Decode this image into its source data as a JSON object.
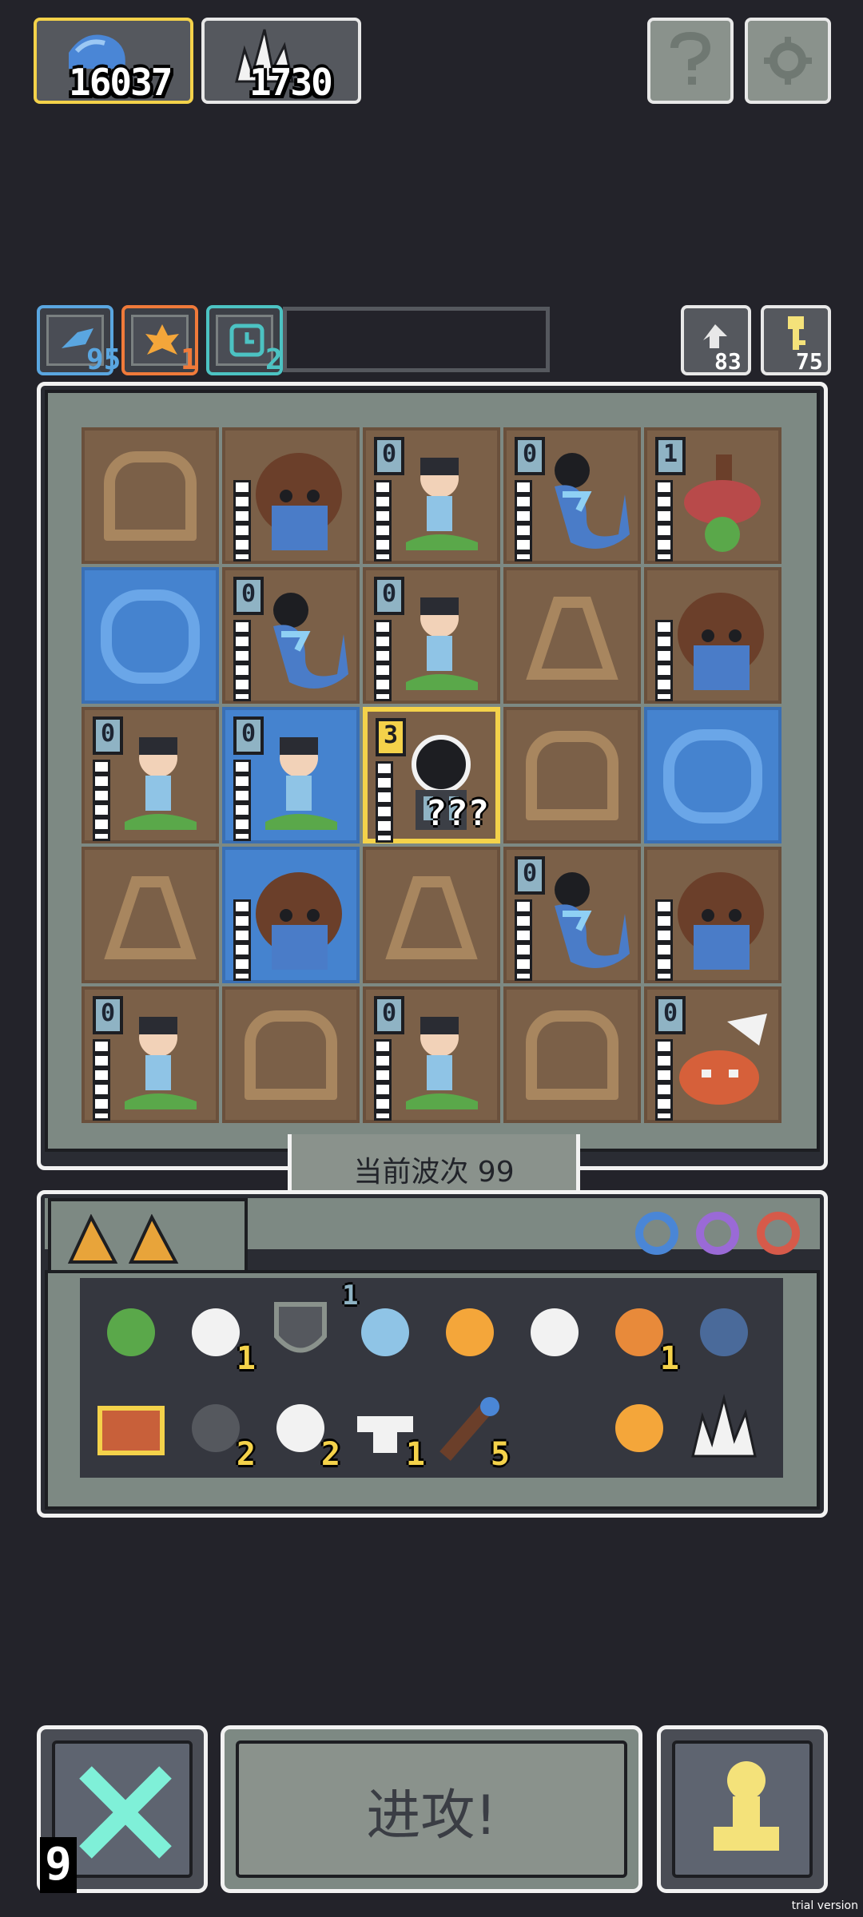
{
  "resources": {
    "water": "16037",
    "crystal": "1730"
  },
  "top_buttons": {
    "help_icon": "question-icon",
    "settings_icon": "gear-icon"
  },
  "status": {
    "skills": [
      {
        "icon": "bird-icon",
        "value": "95",
        "color": "#5aa6e0"
      },
      {
        "icon": "flame-icon",
        "value": "1",
        "color": "#f07a3a"
      },
      {
        "icon": "clock-icon",
        "value": "2",
        "color": "#4cc3c3"
      }
    ],
    "right": [
      {
        "icon": "recycle-icon",
        "value": "83"
      },
      {
        "icon": "key-icon",
        "value": "75"
      }
    ]
  },
  "board": {
    "cells": [
      {
        "tile": "arch",
        "unit": "",
        "level": ""
      },
      {
        "tile": "arch",
        "unit": "tree-golem",
        "level": ""
      },
      {
        "tile": "arch",
        "unit": "snake-maiden",
        "level": "0"
      },
      {
        "tile": "arch",
        "unit": "sea-serpent",
        "level": "0"
      },
      {
        "tile": "arch",
        "unit": "flower-monster",
        "level": "1"
      },
      {
        "tile": "water",
        "unit": "",
        "level": ""
      },
      {
        "tile": "arch",
        "unit": "sea-serpent",
        "level": "0"
      },
      {
        "tile": "arch",
        "unit": "snake-maiden",
        "level": "0"
      },
      {
        "tile": "tri",
        "unit": "",
        "level": ""
      },
      {
        "tile": "arch",
        "unit": "tree-golem",
        "level": ""
      },
      {
        "tile": "arch",
        "unit": "snake-maiden",
        "level": "0"
      },
      {
        "tile": "water",
        "unit": "snake-maiden",
        "level": "0"
      },
      {
        "tile": "sel",
        "unit": "dark-portal",
        "level": "3",
        "mystery": "???"
      },
      {
        "tile": "arch",
        "unit": "",
        "level": ""
      },
      {
        "tile": "water",
        "unit": "",
        "level": ""
      },
      {
        "tile": "tri",
        "unit": "",
        "level": ""
      },
      {
        "tile": "water",
        "unit": "tree-golem",
        "level": ""
      },
      {
        "tile": "tri",
        "unit": "",
        "level": ""
      },
      {
        "tile": "arch",
        "unit": "sea-serpent",
        "level": "0"
      },
      {
        "tile": "arch",
        "unit": "tree-golem",
        "level": ""
      },
      {
        "tile": "arch",
        "unit": "snake-maiden",
        "level": "0"
      },
      {
        "tile": "arch",
        "unit": "",
        "level": ""
      },
      {
        "tile": "arch",
        "unit": "snake-maiden",
        "level": "0"
      },
      {
        "tile": "arch",
        "unit": "",
        "level": ""
      },
      {
        "tile": "arch",
        "unit": "winged-tiger",
        "level": "0"
      }
    ],
    "wave_label": "当前波次 99"
  },
  "inventory": {
    "tabs": [
      "gold-wedge-icon",
      "gold-wedge-icon"
    ],
    "rings": [
      "ring-blue-icon",
      "ring-purple-icon",
      "ring-red-icon"
    ],
    "items": [
      {
        "icon": "herb-icon",
        "count": ""
      },
      {
        "icon": "bone-icon",
        "count": "1"
      },
      {
        "icon": "shield-icon",
        "count": ""
      },
      {
        "icon": "cycle-icon",
        "count": "",
        "top": "1"
      },
      {
        "icon": "meteor-icon",
        "count": ""
      },
      {
        "icon": "boot-icon",
        "count": ""
      },
      {
        "icon": "shrimp-icon",
        "count": "1"
      },
      {
        "icon": "ore-icon",
        "count": ""
      },
      {
        "icon": "map-scroll-icon",
        "count": ""
      },
      {
        "icon": "stairs-icon",
        "count": "2"
      },
      {
        "icon": "cloud-icon",
        "count": "2"
      },
      {
        "icon": "anvil-icon",
        "count": "1"
      },
      {
        "icon": "staff-icon",
        "count": "5"
      },
      {
        "icon": "blank-icon",
        "count": ""
      },
      {
        "icon": "fox-icon",
        "count": ""
      },
      {
        "icon": "crystal-icon",
        "count": ""
      }
    ]
  },
  "bottom": {
    "cancel_count": "9",
    "attack_label": "进攻!",
    "trial": "trial version"
  }
}
